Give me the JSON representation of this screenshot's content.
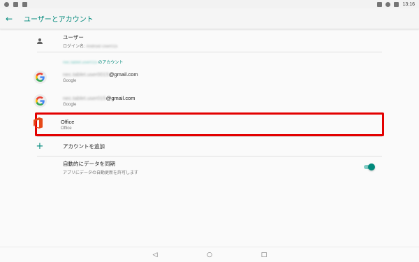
{
  "status_bar": {
    "time": "13:16",
    "left_icons": [
      "location-icon",
      "image-icon",
      "app-icon"
    ],
    "right_icons": [
      "vibrate-icon",
      "wifi-icon",
      "battery-icon"
    ]
  },
  "app_bar": {
    "title": "ユーザーとアカウント",
    "back_icon": "←"
  },
  "user": {
    "name": "ユーザー",
    "login_prefix": "ログイン名: ",
    "login_name": "Android User015"
  },
  "accounts_section": {
    "blurred_prefix": "nec.tablet.user015",
    "label": "のアカウント"
  },
  "accounts": [
    {
      "icon": "google-icon",
      "email_blur": "nec.tablet.user0015",
      "email_suffix": "@gmail.com",
      "type": "Google"
    },
    {
      "icon": "google-icon",
      "email_blur": "nec.tablet.user015",
      "email_suffix": "@gmail.com",
      "type": "Google"
    },
    {
      "icon": "office-icon",
      "name": "Office",
      "type": "Office"
    }
  ],
  "add_account": {
    "label": "アカウントを追加"
  },
  "auto_sync": {
    "title": "自動的にデータを同期",
    "subtitle": "アプリにデータの自動更新を許可します",
    "enabled": true
  },
  "nav": {
    "back": "◁",
    "home": "○",
    "recents": "□"
  },
  "colors": {
    "accent": "#00897b",
    "highlight": "#e30000",
    "toggle_track": "#80cbc4"
  }
}
